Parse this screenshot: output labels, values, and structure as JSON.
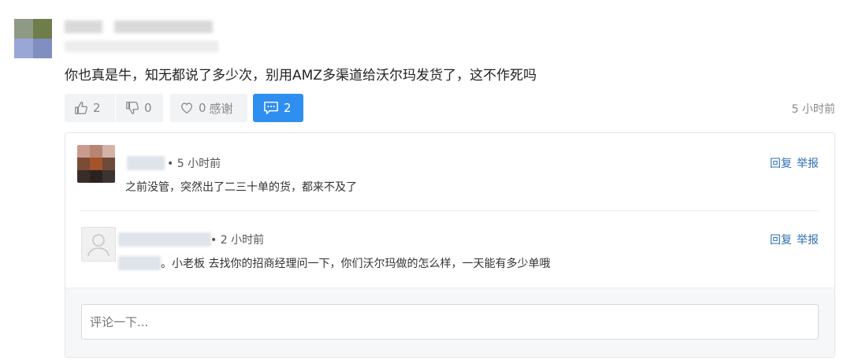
{
  "comment": {
    "text": "你也真是牛，知无都说了多少次，别用AMZ多渠道给沃尔玛发货了，这不作死吗",
    "likes": "2",
    "dislikes": "0",
    "thanks_count": "0",
    "thanks_label": "感谢",
    "replies_count": "2",
    "time": "5 小时前"
  },
  "replies": [
    {
      "time": "• 5 小时前",
      "text": "之前没管，突然出了二三十单的货，都来不及了",
      "reply_label": "回复",
      "report_label": "举报"
    },
    {
      "time": "• 2 小时前",
      "text": "。小老板 去找你的招商经理问一下，你们沃尔玛做的怎么样，一天能有多少单哦",
      "reply_label": "回复",
      "report_label": "举报"
    }
  ],
  "input": {
    "placeholder": "评论一下..."
  },
  "colors": {
    "accent": "#2f8ff0",
    "link": "#2f6fb6",
    "button_bg": "#f2f3f5"
  }
}
